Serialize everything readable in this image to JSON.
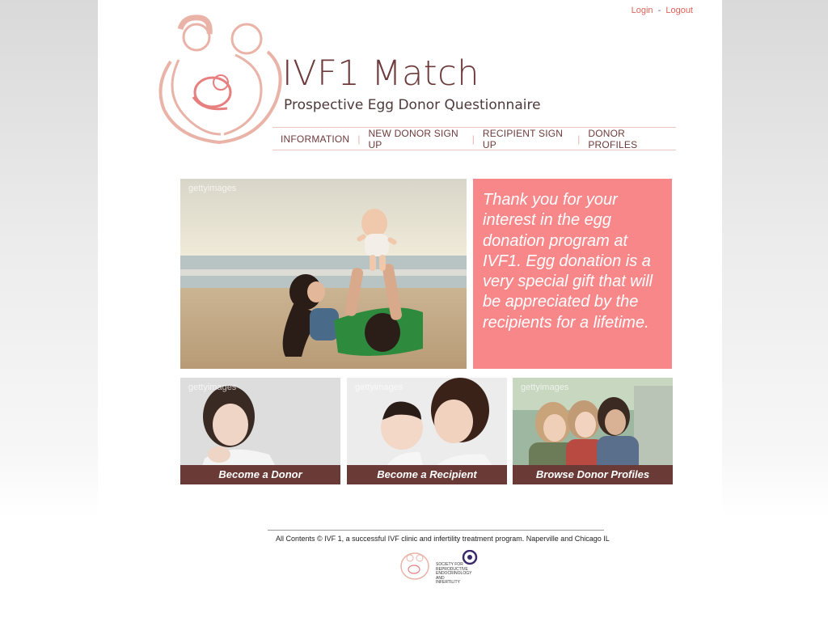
{
  "auth": {
    "login": "Login",
    "separator": "-",
    "logout": "Logout"
  },
  "brand": {
    "title": "IVF1 Match",
    "subtitle": "Prospective Egg Donor Questionnaire"
  },
  "nav": [
    {
      "label": "INFORMATION"
    },
    {
      "label": "NEW DONOR SIGN UP"
    },
    {
      "label": "RECIPIENT SIGN UP"
    },
    {
      "label": "DONOR PROFILES"
    }
  ],
  "hero": {
    "watermark": "gettyimages",
    "quote": "Thank you for your interest in the egg donation program at IVF1. Egg donation is a very special gift that will be appreciated by the recipients for a lifetime."
  },
  "cards": [
    {
      "caption": "Become a Donor",
      "watermark": "gettyimages"
    },
    {
      "caption": "Become a Recipient",
      "watermark": "gettyimages"
    },
    {
      "caption": "Browse Donor Profiles",
      "watermark": "gettyimages"
    }
  ],
  "footer": {
    "text": "All Contents © IVF 1, a successful IVF clinic and infertility treatment program. Naperville and Chicago IL",
    "society": "SOCIETY FOR REPRODUCTIVE ENDOCRINOLOGY AND INFERTILITY"
  },
  "colors": {
    "accent": "#f8878a",
    "brand_brown": "#6d3b3b",
    "caption_bg": "#6a3b36",
    "link": "#e0625a"
  }
}
